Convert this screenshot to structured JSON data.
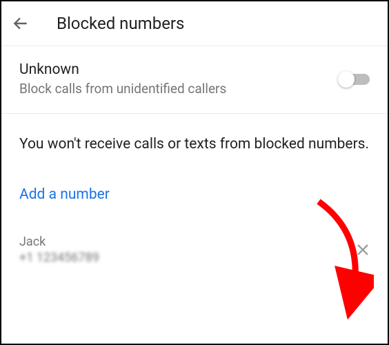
{
  "header": {
    "title": "Blocked numbers"
  },
  "unknown": {
    "title": "Unknown",
    "subtitle": "Block calls from unidentified callers",
    "enabled": false
  },
  "info": "You won't receive calls or texts from blocked numbers.",
  "add_label": "Add a number",
  "blocked": [
    {
      "name": "Jack",
      "number_prefix": "+1",
      "number_rest": " 123456789"
    }
  ]
}
